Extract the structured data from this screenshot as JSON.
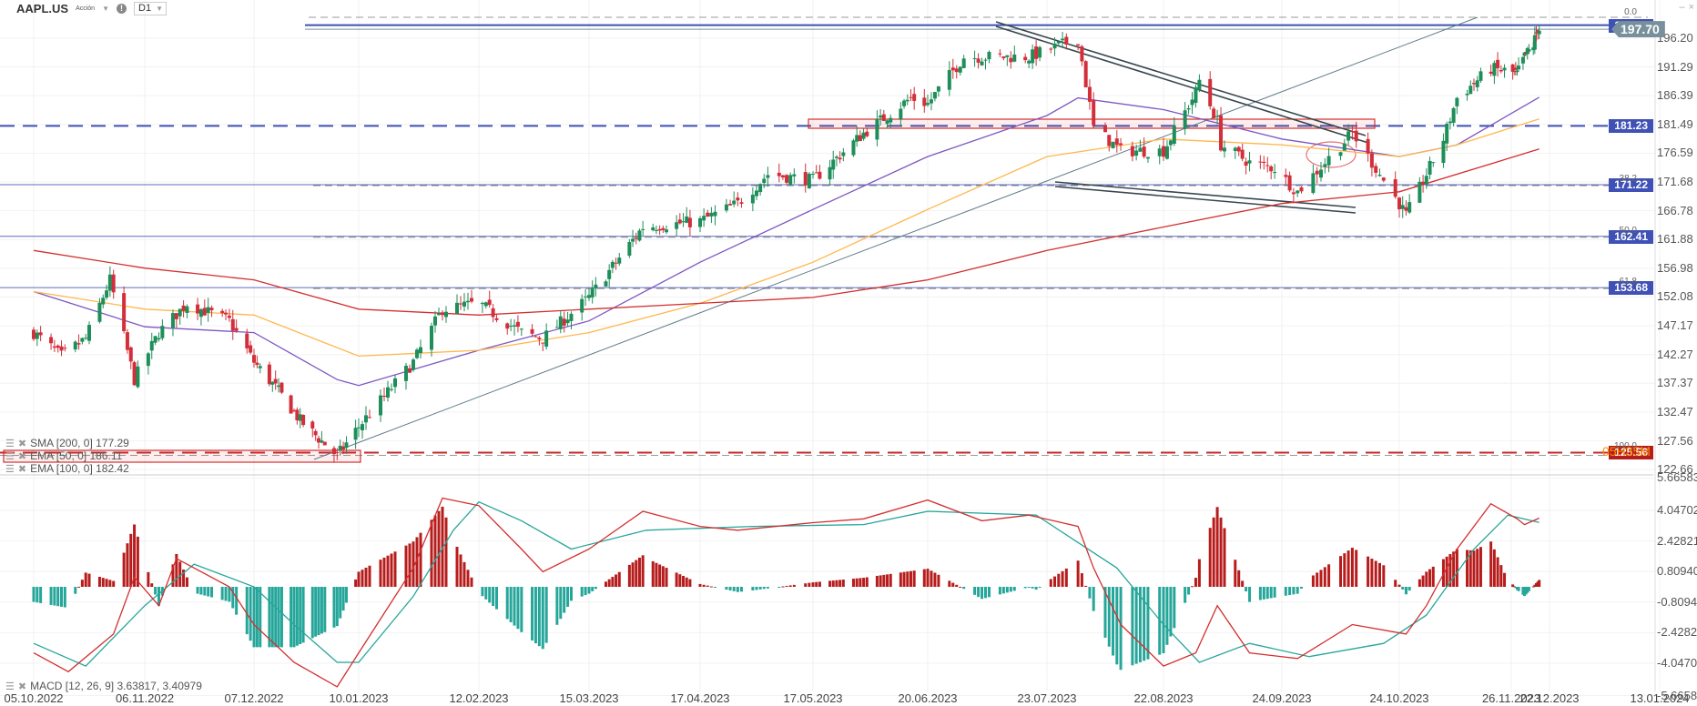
{
  "header": {
    "symbol": "AAPL.US",
    "instrument_type": "Acción",
    "timeframe": "D1",
    "info_icon": "info-icon"
  },
  "window_controls": {
    "minimize": "–",
    "close": "×"
  },
  "indicators": [
    {
      "label": "SMA [200, 0] 177.29",
      "color": "#d32f2f"
    },
    {
      "label": "EMA [50, 0] 186.11",
      "color": "#7e57c2"
    },
    {
      "label": "EMA [100, 0] 182.42",
      "color": "#ffb74d"
    }
  ],
  "macd_legend": "MACD [12, 26, 9] 3.63817, 3.40979",
  "price_tags": {
    "current": "197.70",
    "levels": [
      {
        "value": 198.4,
        "label": "198.40",
        "style": "solid"
      },
      {
        "value": 181.23,
        "label": "181.23",
        "style": "dashed"
      },
      {
        "value": 171.22,
        "label": "171.22",
        "style": "thin"
      },
      {
        "value": 162.41,
        "label": "162.41",
        "style": "thin"
      },
      {
        "value": 153.68,
        "label": "153.68",
        "style": "thin"
      }
    ],
    "red_level": {
      "value": 125.56,
      "label": "125.56"
    },
    "countdown": "05H35M"
  },
  "fib_labels": [
    {
      "value": 199.6,
      "label": "0.0"
    },
    {
      "value": 171.22,
      "label": "38.2"
    },
    {
      "value": 162.41,
      "label": "50.0"
    },
    {
      "value": 153.68,
      "label": "61.8"
    },
    {
      "value": 125.56,
      "label": "100.0"
    }
  ],
  "chart_data": {
    "type": "candlestick",
    "symbol": "AAPL.US",
    "price_axis": {
      "ticks": [
        "196.20",
        "191.29",
        "186.39",
        "181.49",
        "176.59",
        "171.68",
        "166.78",
        "161.88",
        "156.98",
        "152.08",
        "147.17",
        "142.27",
        "137.37",
        "132.47",
        "127.56",
        "122.66"
      ],
      "range": [
        122.66,
        198.4
      ]
    },
    "macd_axis": {
      "ticks": [
        "5.66583",
        "4.04702",
        "2.42821",
        "0.80940",
        "-0.80940",
        "-2.42821",
        "-4.04702",
        "-5.66583"
      ],
      "range": [
        -5.66583,
        5.66583
      ]
    },
    "x_ticks": [
      "05.10.2022",
      "06.11.2022",
      "07.12.2022",
      "10.01.2023",
      "12.02.2023",
      "15.03.2023",
      "17.04.2023",
      "17.05.2023",
      "20.06.2023",
      "23.07.2023",
      "22.08.2023",
      "24.09.2023",
      "24.10.2023",
      "26.11.2023",
      "22.12.2023",
      "13.01.2024"
    ],
    "close_path": [
      [
        "2022-10-05",
        146
      ],
      [
        "2022-10-13",
        142
      ],
      [
        "2022-10-20",
        145
      ],
      [
        "2022-10-27",
        155
      ],
      [
        "2022-11-03",
        138
      ],
      [
        "2022-11-10",
        146
      ],
      [
        "2022-11-18",
        151
      ],
      [
        "2022-11-30",
        148
      ],
      [
        "2022-12-07",
        141
      ],
      [
        "2022-12-15",
        136
      ],
      [
        "2022-12-22",
        131
      ],
      [
        "2023-01-03",
        125
      ],
      [
        "2023-01-10",
        130
      ],
      [
        "2023-01-25",
        141
      ],
      [
        "2023-02-02",
        150
      ],
      [
        "2023-02-12",
        151
      ],
      [
        "2023-02-24",
        146
      ],
      [
        "2023-03-02",
        145
      ],
      [
        "2023-03-15",
        152
      ],
      [
        "2023-03-31",
        164
      ],
      [
        "2023-04-17",
        165
      ],
      [
        "2023-04-27",
        168
      ],
      [
        "2023-05-05",
        173
      ],
      [
        "2023-05-17",
        172
      ],
      [
        "2023-06-01",
        180
      ],
      [
        "2023-06-15",
        186
      ],
      [
        "2023-06-20",
        185
      ],
      [
        "2023-06-30",
        193
      ],
      [
        "2023-07-18",
        193
      ],
      [
        "2023-07-31",
        196
      ],
      [
        "2023-08-04",
        181
      ],
      [
        "2023-08-11",
        177
      ],
      [
        "2023-08-22",
        177
      ],
      [
        "2023-08-31",
        187
      ],
      [
        "2023-09-01",
        189
      ],
      [
        "2023-09-06",
        182
      ],
      [
        "2023-09-07",
        178
      ],
      [
        "2023-09-15",
        175
      ],
      [
        "2023-09-22",
        174
      ],
      [
        "2023-09-28",
        170
      ],
      [
        "2023-10-12",
        180
      ],
      [
        "2023-10-20",
        172
      ],
      [
        "2023-10-26",
        166
      ],
      [
        "2023-11-01",
        173
      ],
      [
        "2023-11-06",
        179
      ],
      [
        "2023-11-10",
        186
      ],
      [
        "2023-11-20",
        191
      ],
      [
        "2023-11-30",
        190
      ],
      [
        "2023-12-05",
        193
      ],
      [
        "2023-12-11",
        195
      ],
      [
        "2023-12-14",
        198
      ],
      [
        "2023-12-15",
        197.7
      ]
    ],
    "series": [
      {
        "name": "EMA 50",
        "color": "#7e57c2",
        "points": [
          [
            "2022-10-05",
            153
          ],
          [
            "2022-11-06",
            147
          ],
          [
            "2022-12-07",
            146
          ],
          [
            "2023-01-03",
            138
          ],
          [
            "2023-01-10",
            137
          ],
          [
            "2023-02-12",
            143
          ],
          [
            "2023-03-15",
            148
          ],
          [
            "2023-04-17",
            158
          ],
          [
            "2023-05-17",
            167
          ],
          [
            "2023-06-20",
            176
          ],
          [
            "2023-07-23",
            183
          ],
          [
            "2023-07-31",
            186
          ],
          [
            "2023-08-22",
            184
          ],
          [
            "2023-09-24",
            179
          ],
          [
            "2023-10-24",
            176
          ],
          [
            "2023-11-10",
            178
          ],
          [
            "2023-12-15",
            186.11
          ]
        ]
      },
      {
        "name": "EMA 100",
        "color": "#ffb74d",
        "points": [
          [
            "2022-10-05",
            153
          ],
          [
            "2022-11-06",
            150
          ],
          [
            "2022-12-07",
            149
          ],
          [
            "2023-01-10",
            142
          ],
          [
            "2023-02-12",
            143
          ],
          [
            "2023-03-15",
            146
          ],
          [
            "2023-04-17",
            151
          ],
          [
            "2023-05-17",
            158
          ],
          [
            "2023-06-20",
            167
          ],
          [
            "2023-07-23",
            176
          ],
          [
            "2023-08-22",
            179
          ],
          [
            "2023-09-24",
            178
          ],
          [
            "2023-10-24",
            176
          ],
          [
            "2023-11-10",
            178
          ],
          [
            "2023-12-15",
            182.42
          ]
        ]
      },
      {
        "name": "SMA 200",
        "color": "#d32f2f",
        "points": [
          [
            "2022-10-05",
            160
          ],
          [
            "2022-11-06",
            157
          ],
          [
            "2022-12-07",
            155
          ],
          [
            "2023-01-10",
            150
          ],
          [
            "2023-02-12",
            149
          ],
          [
            "2023-03-15",
            150
          ],
          [
            "2023-04-17",
            151
          ],
          [
            "2023-05-17",
            152
          ],
          [
            "2023-06-20",
            155
          ],
          [
            "2023-07-23",
            160
          ],
          [
            "2023-08-22",
            164
          ],
          [
            "2023-09-24",
            168
          ],
          [
            "2023-10-24",
            170
          ],
          [
            "2023-12-15",
            177.29
          ]
        ]
      }
    ],
    "macd": {
      "macd_line": [
        [
          "2022-10-05",
          -3.5
        ],
        [
          "2022-10-15",
          -4.5
        ],
        [
          "2022-10-28",
          -2.5
        ],
        [
          "2022-11-03",
          0.5
        ],
        [
          "2022-11-10",
          -1
        ],
        [
          "2022-11-15",
          1.5
        ],
        [
          "2022-11-30",
          0
        ],
        [
          "2022-12-07",
          -2
        ],
        [
          "2022-12-20",
          -4
        ],
        [
          "2023-01-03",
          -5.3
        ],
        [
          "2023-01-10",
          -3.5
        ],
        [
          "2023-01-25",
          1
        ],
        [
          "2023-02-02",
          4.7
        ],
        [
          "2023-02-12",
          4.3
        ],
        [
          "2023-02-24",
          2
        ],
        [
          "2023-03-02",
          0.8
        ],
        [
          "2023-03-15",
          2
        ],
        [
          "2023-03-31",
          4
        ],
        [
          "2023-04-17",
          3.2
        ],
        [
          "2023-04-27",
          3
        ],
        [
          "2023-05-17",
          3.4
        ],
        [
          "2023-06-01",
          3.6
        ],
        [
          "2023-06-20",
          4.6
        ],
        [
          "2023-07-05",
          3.5
        ],
        [
          "2023-07-18",
          3.8
        ],
        [
          "2023-07-31",
          3.2
        ],
        [
          "2023-08-04",
          1
        ],
        [
          "2023-08-11",
          -2
        ],
        [
          "2023-08-22",
          -4.2
        ],
        [
          "2023-08-31",
          -3.5
        ],
        [
          "2023-09-06",
          -1
        ],
        [
          "2023-09-15",
          -3.5
        ],
        [
          "2023-09-28",
          -3.8
        ],
        [
          "2023-10-12",
          -2
        ],
        [
          "2023-10-26",
          -2.5
        ],
        [
          "2023-11-01",
          -1
        ],
        [
          "2023-11-10",
          2
        ],
        [
          "2023-11-20",
          4.4
        ],
        [
          "2023-11-30",
          3.6
        ],
        [
          "2023-12-05",
          3.3
        ],
        [
          "2023-12-15",
          3.63817
        ]
      ],
      "signal_line": [
        [
          "2022-10-05",
          -3
        ],
        [
          "2022-10-20",
          -4.2
        ],
        [
          "2022-11-06",
          -1
        ],
        [
          "2022-11-20",
          1.2
        ],
        [
          "2022-12-07",
          0
        ],
        [
          "2022-12-20",
          -2
        ],
        [
          "2023-01-03",
          -4
        ],
        [
          "2023-01-10",
          -4
        ],
        [
          "2023-01-25",
          -0.5
        ],
        [
          "2023-02-05",
          3
        ],
        [
          "2023-02-12",
          4.5
        ],
        [
          "2023-02-24",
          3.5
        ],
        [
          "2023-03-10",
          2
        ],
        [
          "2023-04-01",
          3
        ],
        [
          "2023-05-01",
          3.2
        ],
        [
          "2023-06-01",
          3.3
        ],
        [
          "2023-06-20",
          4
        ],
        [
          "2023-07-20",
          3.8
        ],
        [
          "2023-08-10",
          1
        ],
        [
          "2023-08-22",
          -2
        ],
        [
          "2023-09-01",
          -4
        ],
        [
          "2023-09-15",
          -3
        ],
        [
          "2023-10-01",
          -3.7
        ],
        [
          "2023-10-20",
          -3
        ],
        [
          "2023-11-01",
          -1.5
        ],
        [
          "2023-11-15",
          2
        ],
        [
          "2023-11-25",
          3.8
        ],
        [
          "2023-12-15",
          3.40979
        ]
      ],
      "macd_color": "#d32f2f",
      "signal_color": "#26a69a",
      "hist_up_color": "#b71c1c",
      "hist_down_color": "#26a69a"
    },
    "candle_colors": {
      "up": "#1e8e5a",
      "down": "#d32f3a"
    }
  }
}
